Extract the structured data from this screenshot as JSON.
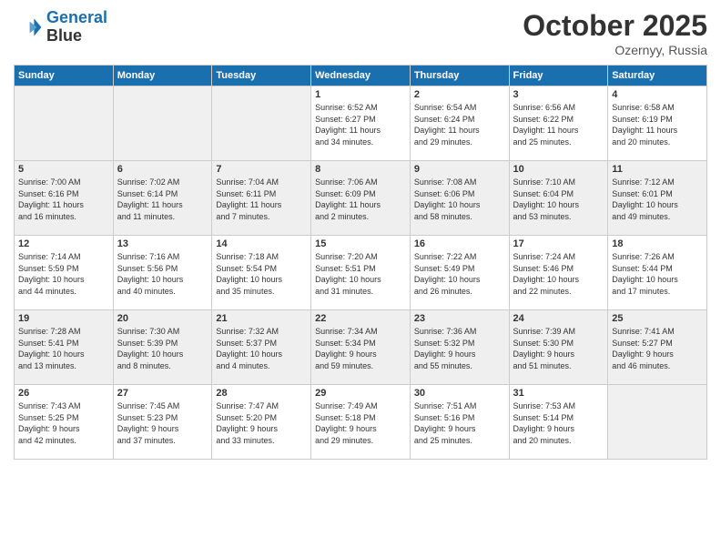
{
  "header": {
    "logo_line1": "General",
    "logo_line2": "Blue",
    "month_year": "October 2025",
    "location": "Ozernyy, Russia"
  },
  "weekdays": [
    "Sunday",
    "Monday",
    "Tuesday",
    "Wednesday",
    "Thursday",
    "Friday",
    "Saturday"
  ],
  "weeks": [
    [
      {
        "day": "",
        "info": ""
      },
      {
        "day": "",
        "info": ""
      },
      {
        "day": "",
        "info": ""
      },
      {
        "day": "1",
        "info": "Sunrise: 6:52 AM\nSunset: 6:27 PM\nDaylight: 11 hours\nand 34 minutes."
      },
      {
        "day": "2",
        "info": "Sunrise: 6:54 AM\nSunset: 6:24 PM\nDaylight: 11 hours\nand 29 minutes."
      },
      {
        "day": "3",
        "info": "Sunrise: 6:56 AM\nSunset: 6:22 PM\nDaylight: 11 hours\nand 25 minutes."
      },
      {
        "day": "4",
        "info": "Sunrise: 6:58 AM\nSunset: 6:19 PM\nDaylight: 11 hours\nand 20 minutes."
      }
    ],
    [
      {
        "day": "5",
        "info": "Sunrise: 7:00 AM\nSunset: 6:16 PM\nDaylight: 11 hours\nand 16 minutes."
      },
      {
        "day": "6",
        "info": "Sunrise: 7:02 AM\nSunset: 6:14 PM\nDaylight: 11 hours\nand 11 minutes."
      },
      {
        "day": "7",
        "info": "Sunrise: 7:04 AM\nSunset: 6:11 PM\nDaylight: 11 hours\nand 7 minutes."
      },
      {
        "day": "8",
        "info": "Sunrise: 7:06 AM\nSunset: 6:09 PM\nDaylight: 11 hours\nand 2 minutes."
      },
      {
        "day": "9",
        "info": "Sunrise: 7:08 AM\nSunset: 6:06 PM\nDaylight: 10 hours\nand 58 minutes."
      },
      {
        "day": "10",
        "info": "Sunrise: 7:10 AM\nSunset: 6:04 PM\nDaylight: 10 hours\nand 53 minutes."
      },
      {
        "day": "11",
        "info": "Sunrise: 7:12 AM\nSunset: 6:01 PM\nDaylight: 10 hours\nand 49 minutes."
      }
    ],
    [
      {
        "day": "12",
        "info": "Sunrise: 7:14 AM\nSunset: 5:59 PM\nDaylight: 10 hours\nand 44 minutes."
      },
      {
        "day": "13",
        "info": "Sunrise: 7:16 AM\nSunset: 5:56 PM\nDaylight: 10 hours\nand 40 minutes."
      },
      {
        "day": "14",
        "info": "Sunrise: 7:18 AM\nSunset: 5:54 PM\nDaylight: 10 hours\nand 35 minutes."
      },
      {
        "day": "15",
        "info": "Sunrise: 7:20 AM\nSunset: 5:51 PM\nDaylight: 10 hours\nand 31 minutes."
      },
      {
        "day": "16",
        "info": "Sunrise: 7:22 AM\nSunset: 5:49 PM\nDaylight: 10 hours\nand 26 minutes."
      },
      {
        "day": "17",
        "info": "Sunrise: 7:24 AM\nSunset: 5:46 PM\nDaylight: 10 hours\nand 22 minutes."
      },
      {
        "day": "18",
        "info": "Sunrise: 7:26 AM\nSunset: 5:44 PM\nDaylight: 10 hours\nand 17 minutes."
      }
    ],
    [
      {
        "day": "19",
        "info": "Sunrise: 7:28 AM\nSunset: 5:41 PM\nDaylight: 10 hours\nand 13 minutes."
      },
      {
        "day": "20",
        "info": "Sunrise: 7:30 AM\nSunset: 5:39 PM\nDaylight: 10 hours\nand 8 minutes."
      },
      {
        "day": "21",
        "info": "Sunrise: 7:32 AM\nSunset: 5:37 PM\nDaylight: 10 hours\nand 4 minutes."
      },
      {
        "day": "22",
        "info": "Sunrise: 7:34 AM\nSunset: 5:34 PM\nDaylight: 9 hours\nand 59 minutes."
      },
      {
        "day": "23",
        "info": "Sunrise: 7:36 AM\nSunset: 5:32 PM\nDaylight: 9 hours\nand 55 minutes."
      },
      {
        "day": "24",
        "info": "Sunrise: 7:39 AM\nSunset: 5:30 PM\nDaylight: 9 hours\nand 51 minutes."
      },
      {
        "day": "25",
        "info": "Sunrise: 7:41 AM\nSunset: 5:27 PM\nDaylight: 9 hours\nand 46 minutes."
      }
    ],
    [
      {
        "day": "26",
        "info": "Sunrise: 7:43 AM\nSunset: 5:25 PM\nDaylight: 9 hours\nand 42 minutes."
      },
      {
        "day": "27",
        "info": "Sunrise: 7:45 AM\nSunset: 5:23 PM\nDaylight: 9 hours\nand 37 minutes."
      },
      {
        "day": "28",
        "info": "Sunrise: 7:47 AM\nSunset: 5:20 PM\nDaylight: 9 hours\nand 33 minutes."
      },
      {
        "day": "29",
        "info": "Sunrise: 7:49 AM\nSunset: 5:18 PM\nDaylight: 9 hours\nand 29 minutes."
      },
      {
        "day": "30",
        "info": "Sunrise: 7:51 AM\nSunset: 5:16 PM\nDaylight: 9 hours\nand 25 minutes."
      },
      {
        "day": "31",
        "info": "Sunrise: 7:53 AM\nSunset: 5:14 PM\nDaylight: 9 hours\nand 20 minutes."
      },
      {
        "day": "",
        "info": ""
      }
    ]
  ]
}
